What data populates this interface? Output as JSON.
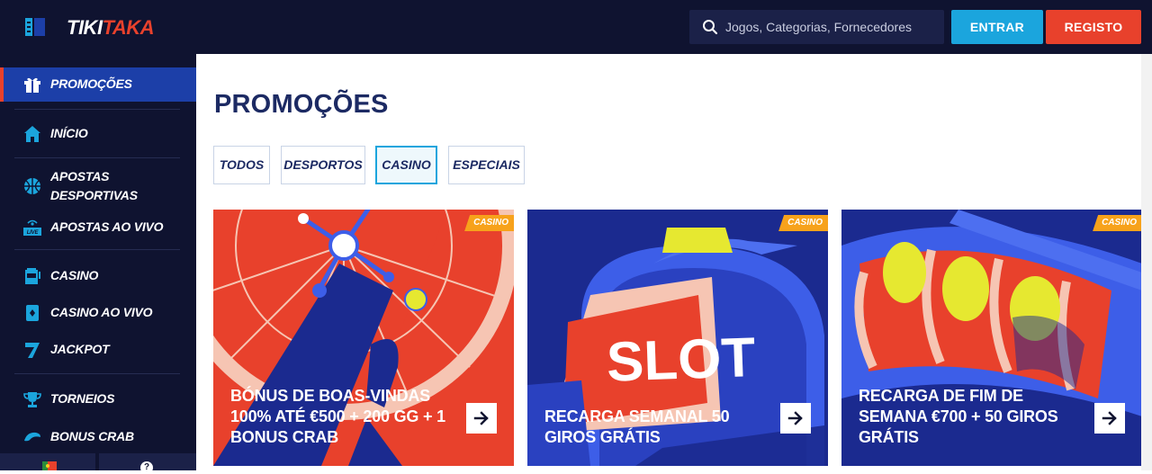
{
  "brand": {
    "part1": "TIKI",
    "part2": "TAKA"
  },
  "search": {
    "placeholder": "Jogos, Categorias, Fornecedores"
  },
  "header": {
    "login_label": "ENTRAR",
    "register_label": "REGISTO"
  },
  "sidebar": {
    "items": [
      {
        "label": "PROMOÇÕES",
        "icon": "gift-icon",
        "active": true
      },
      {
        "label": "INÍCIO",
        "icon": "home-icon"
      },
      {
        "label": "APOSTAS DESPORTIVAS",
        "icon": "basketball-icon"
      },
      {
        "label": "APOSTAS AO VIVO",
        "icon": "live-icon"
      },
      {
        "label": "CASINO",
        "icon": "slot-machine-icon"
      },
      {
        "label": "CASINO AO VIVO",
        "icon": "live-casino-icon"
      },
      {
        "label": "JACKPOT",
        "icon": "seven-icon"
      },
      {
        "label": "TORNEIOS",
        "icon": "trophy-icon"
      },
      {
        "label": "BONUS CRAB",
        "icon": "crab-icon"
      }
    ],
    "bottom": {
      "help_label": "?"
    }
  },
  "main": {
    "title": "PROMOÇÕES",
    "tabs": [
      {
        "label": "TODOS"
      },
      {
        "label": "DESPORTOS"
      },
      {
        "label": "CASINO",
        "active": true
      },
      {
        "label": "ESPECIAIS"
      }
    ],
    "cards": [
      {
        "badge": "CASINO",
        "title": "BÓNUS DE BOAS-VINDAS 100% ATÉ €500 + 200 GG + 1 BONUS CRAB",
        "art": "roulette"
      },
      {
        "badge": "CASINO",
        "title": "RECARGA SEMANAL 50 GIROS GRÁTIS",
        "art": "slot-sign",
        "art_text": "SLOT"
      },
      {
        "badge": "CASINO",
        "title": "RECARGA DE FIM DE SEMANA €700 + 50 GIROS GRÁTIS",
        "art": "slot-reels"
      }
    ]
  },
  "colors": {
    "navy": "#0f1330",
    "accent_blue": "#1ba5dd",
    "accent_red": "#e8412c",
    "badge_orange": "#f7a21b",
    "title_navy": "#1c2a63"
  }
}
